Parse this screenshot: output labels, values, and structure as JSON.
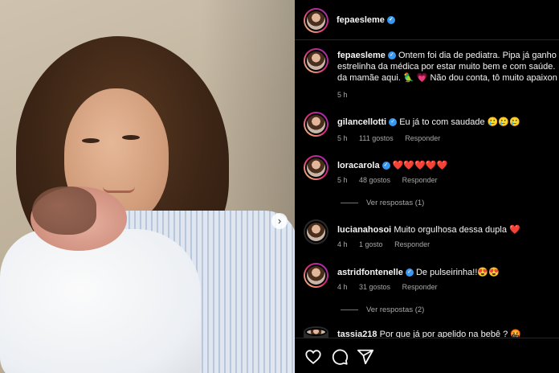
{
  "colors": {
    "background": "#000000",
    "verified": "#3897f0",
    "heart": "#ed4956",
    "meta": "#a8a8a8"
  },
  "photo": {
    "next_icon": "chevron-right-icon"
  },
  "post": {
    "author": "fepaesleme",
    "caption": {
      "username": "fepaesleme",
      "line1": "Ontem foi dia de pediatra. Pipa já ganho",
      "line2": "estrelinha da médica por estar muito bem e com saúde.",
      "line3_a": "da mamãe aqui. ",
      "line3_emoji": "🦜",
      "line3_heart": "💗",
      "line3_b": " Não dou conta, tô muito apaixon",
      "time": "5 h"
    }
  },
  "comments": [
    {
      "username": "gilancellotti",
      "verified": true,
      "text": "Eu já to com saudade 🥲🥲🥲",
      "time": "5 h",
      "likes": "111 gostos",
      "reply": "Responder"
    },
    {
      "username": "loracarola",
      "verified": true,
      "text": "❤️❤️❤️❤️❤️",
      "time": "5 h",
      "likes": "48 gostos",
      "reply": "Responder",
      "view_replies": "Ver respostas (1)"
    },
    {
      "username": "lucianahosoi",
      "verified": false,
      "text": "Muito orgulhosa dessa dupla ❤️",
      "time": "4 h",
      "likes": "1 gosto",
      "reply": "Responder"
    },
    {
      "username": "astridfontenelle",
      "verified": true,
      "text": "De pulseirinha!!😍😍",
      "time": "4 h",
      "likes": "31 gostos",
      "reply": "Responder",
      "view_replies": "Ver respostas (2)"
    },
    {
      "username": "tassia218",
      "verified": false,
      "text": "Por que já por apelido na bebê ? 🤬"
    }
  ],
  "actions": [
    "heart-icon",
    "comment-icon",
    "share-icon"
  ]
}
